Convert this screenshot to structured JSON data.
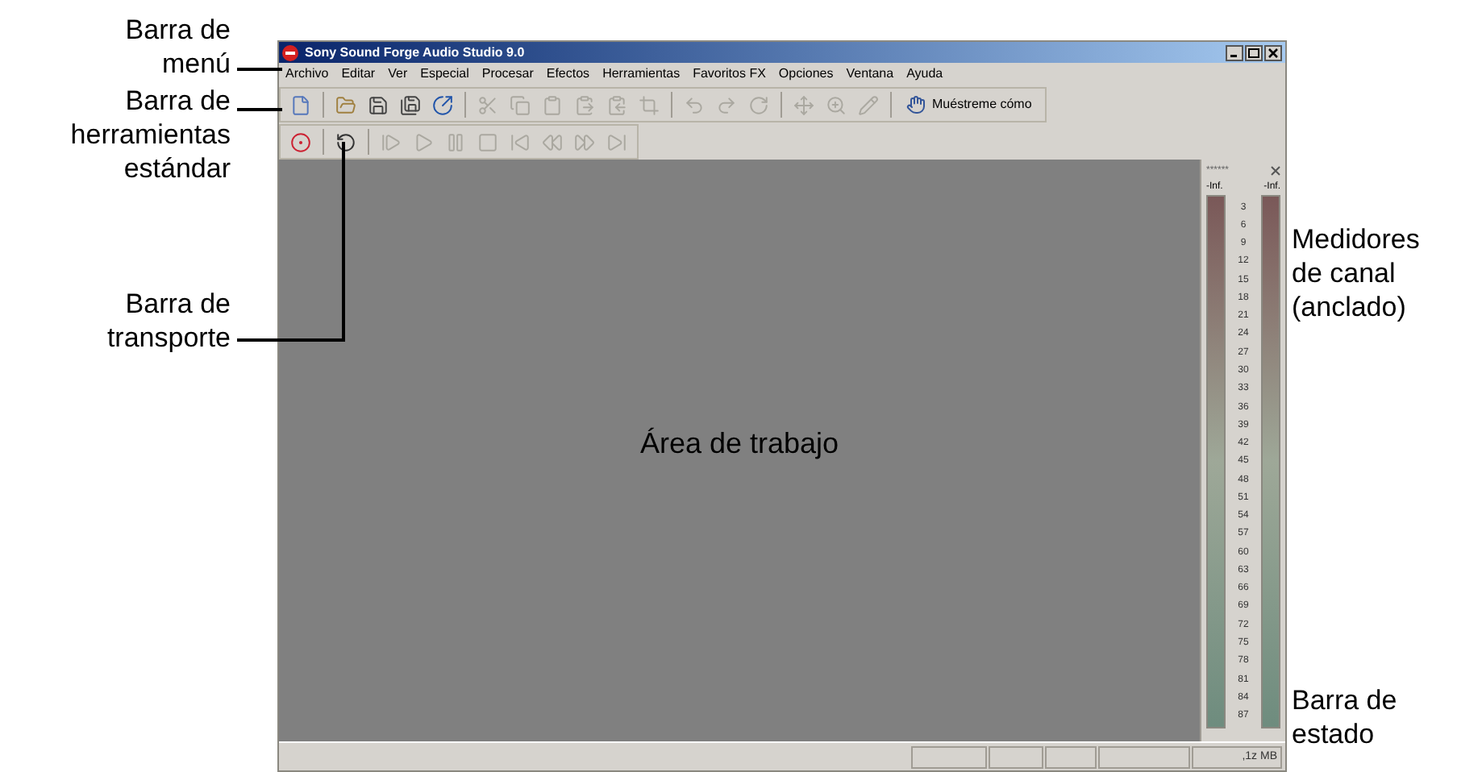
{
  "window": {
    "title": "Sony Sound Forge Audio Studio 9.0"
  },
  "menu": [
    "Archivo",
    "Editar",
    "Ver",
    "Especial",
    "Procesar",
    "Efectos",
    "Herramientas",
    "Favoritos FX",
    "Opciones",
    "Ventana",
    "Ayuda"
  ],
  "standard_toolbar": [
    {
      "kind": "new",
      "disabled": false
    },
    {
      "kind": "separator"
    },
    {
      "kind": "open",
      "disabled": false
    },
    {
      "kind": "save",
      "disabled": false
    },
    {
      "kind": "save-as",
      "disabled": false
    },
    {
      "kind": "publish",
      "disabled": false
    },
    {
      "kind": "separator"
    },
    {
      "kind": "cut",
      "disabled": true
    },
    {
      "kind": "copy",
      "disabled": true
    },
    {
      "kind": "paste",
      "disabled": true
    },
    {
      "kind": "paste-mix",
      "disabled": true
    },
    {
      "kind": "paste-crossfade",
      "disabled": true
    },
    {
      "kind": "trim",
      "disabled": true
    },
    {
      "kind": "separator"
    },
    {
      "kind": "undo",
      "disabled": true
    },
    {
      "kind": "redo",
      "disabled": true
    },
    {
      "kind": "repeat",
      "disabled": true
    },
    {
      "kind": "separator"
    },
    {
      "kind": "edit-tool",
      "disabled": true
    },
    {
      "kind": "magnify",
      "disabled": true
    },
    {
      "kind": "pencil",
      "disabled": true
    },
    {
      "kind": "separator"
    },
    {
      "kind": "show-me",
      "label": "Muéstreme cómo",
      "disabled": false
    }
  ],
  "transport_toolbar": [
    {
      "kind": "record",
      "disabled": false
    },
    {
      "kind": "separator"
    },
    {
      "kind": "loop",
      "disabled": false
    },
    {
      "kind": "separator"
    },
    {
      "kind": "play-all",
      "disabled": true
    },
    {
      "kind": "play",
      "disabled": true
    },
    {
      "kind": "pause",
      "disabled": true
    },
    {
      "kind": "stop",
      "disabled": true
    },
    {
      "kind": "go-start",
      "disabled": true
    },
    {
      "kind": "rewind",
      "disabled": true
    },
    {
      "kind": "forward",
      "disabled": true
    },
    {
      "kind": "go-end",
      "disabled": true
    }
  ],
  "workspace": {
    "label": "Área de trabajo"
  },
  "meters": {
    "title": "******",
    "channels": [
      {
        "peak": "-Inf."
      },
      {
        "peak": "-Inf."
      }
    ],
    "scale": [
      "3",
      "6",
      "9",
      "12",
      "15",
      "18",
      "21",
      "24",
      "27",
      "30",
      "33",
      "36",
      "39",
      "42",
      "45",
      "48",
      "51",
      "54",
      "57",
      "60",
      "63",
      "66",
      "69",
      "72",
      "75",
      "78",
      "81",
      "84",
      "87"
    ]
  },
  "status_bar": {
    "memory": ",1z MB"
  },
  "annotations": [
    {
      "kind": "menu",
      "text": "Barra de\nmenú"
    },
    {
      "kind": "standard",
      "text": "Barra de\nherramientas\nestándar"
    },
    {
      "kind": "transport",
      "text": "Barra de\ntransporte"
    },
    {
      "kind": "meters",
      "text": "Medidores\nde canal\n(anclado)"
    },
    {
      "kind": "status",
      "text": "Barra de\nestado"
    }
  ]
}
